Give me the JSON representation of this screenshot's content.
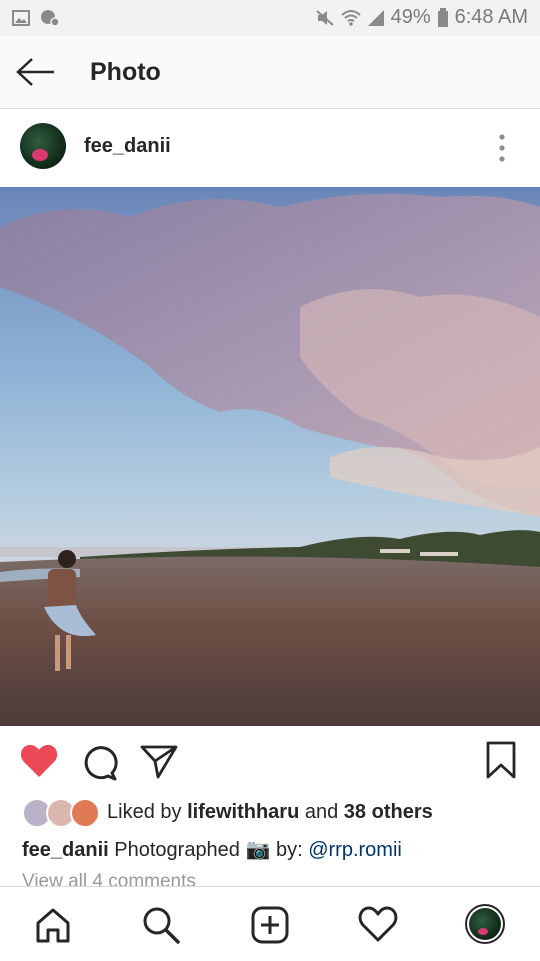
{
  "status_bar": {
    "battery": "49%",
    "time": "6:48 AM"
  },
  "header": {
    "title": "Photo"
  },
  "post": {
    "username": "fee_danii",
    "likes": {
      "prefix": "Liked by",
      "first_liker": "lifewithharu",
      "connector": "and",
      "others": "38 others"
    },
    "caption": {
      "username": "fee_danii",
      "text_before": "Photographed",
      "camera_emoji": "📷",
      "text_after": "by:",
      "mention": "@rrp.romii"
    },
    "view_comments": "View all 4 comments",
    "liked": true,
    "like_color": "#ed4956"
  },
  "icons": {
    "status_left": [
      "image-icon",
      "location-settings-icon"
    ],
    "status_right": [
      "mute-icon",
      "wifi-icon",
      "signal-icon",
      "battery-icon"
    ],
    "actions": [
      "heart-icon",
      "comment-icon",
      "share-icon",
      "bookmark-icon"
    ],
    "nav": [
      "home-icon",
      "search-icon",
      "add-post-icon",
      "activity-heart-icon",
      "profile-icon"
    ]
  }
}
